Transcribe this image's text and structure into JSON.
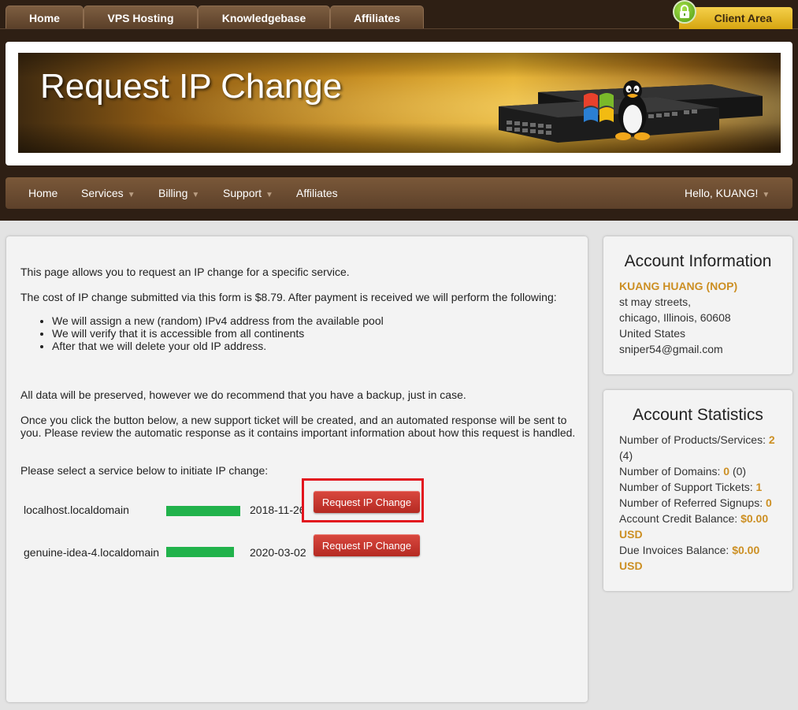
{
  "top_tabs": [
    "Home",
    "VPS Hosting",
    "Knowledgebase",
    "Affiliates"
  ],
  "client_area_label": "Client Area",
  "banner_title": "Request IP Change",
  "nav": {
    "home": "Home",
    "services": "Services",
    "billing": "Billing",
    "support": "Support",
    "affiliates": "Affiliates",
    "greeting": "Hello, KUANG!"
  },
  "intro": "This page allows you to request an IP change for a specific service.",
  "cost_text": "The cost of IP change submitted via this form is $8.79. After payment is received we will perform the following:",
  "steps": [
    "We will assign a new (random) IPv4 address from the available pool",
    "We will verify that it is accessible from all continents",
    "After that we will delete your old IP address."
  ],
  "preserve_text": "All data will be preserved, however we do recommend that you have a backup, just in case.",
  "ticket_text": "Once you click the button below, a new support ticket will be created, and an automated response will be sent to you. Please review the automatic response as it contains important information about how this request is handled.",
  "select_text": "Please select a service below to initiate IP change:",
  "services": [
    {
      "name": "localhost.localdomain",
      "date": "2018-11-26",
      "button": "Request IP Change"
    },
    {
      "name": "genuine-idea-4.localdomain",
      "date": "2020-03-02",
      "button": "Request IP Change"
    }
  ],
  "account_info": {
    "title": "Account Information",
    "name": "KUANG HUANG (NOP)",
    "street": "st may streets,",
    "city": "chicago, Illinois, 60608",
    "country": "United States",
    "email": "sniper54@gmail.com"
  },
  "account_stats": {
    "title": "Account Statistics",
    "products_label": "Number of Products/Services:",
    "products_value": "2",
    "products_extra": "(4)",
    "domains_label": "Number of Domains:",
    "domains_value": "0",
    "domains_extra": "(0)",
    "tickets_label": "Number of Support Tickets:",
    "tickets_value": "1",
    "referred_label": "Number of Referred Signups:",
    "referred_value": "0",
    "credit_label": "Account Credit Balance:",
    "credit_value": "$0.00 USD",
    "due_label": "Due Invoices Balance:",
    "due_value": "$0.00 USD"
  },
  "colors": {
    "accent_gold": "#cc8f23",
    "button_red": "#c0342c",
    "highlight_red": "#e2141e",
    "masked_bar_green": "#21b24b"
  }
}
